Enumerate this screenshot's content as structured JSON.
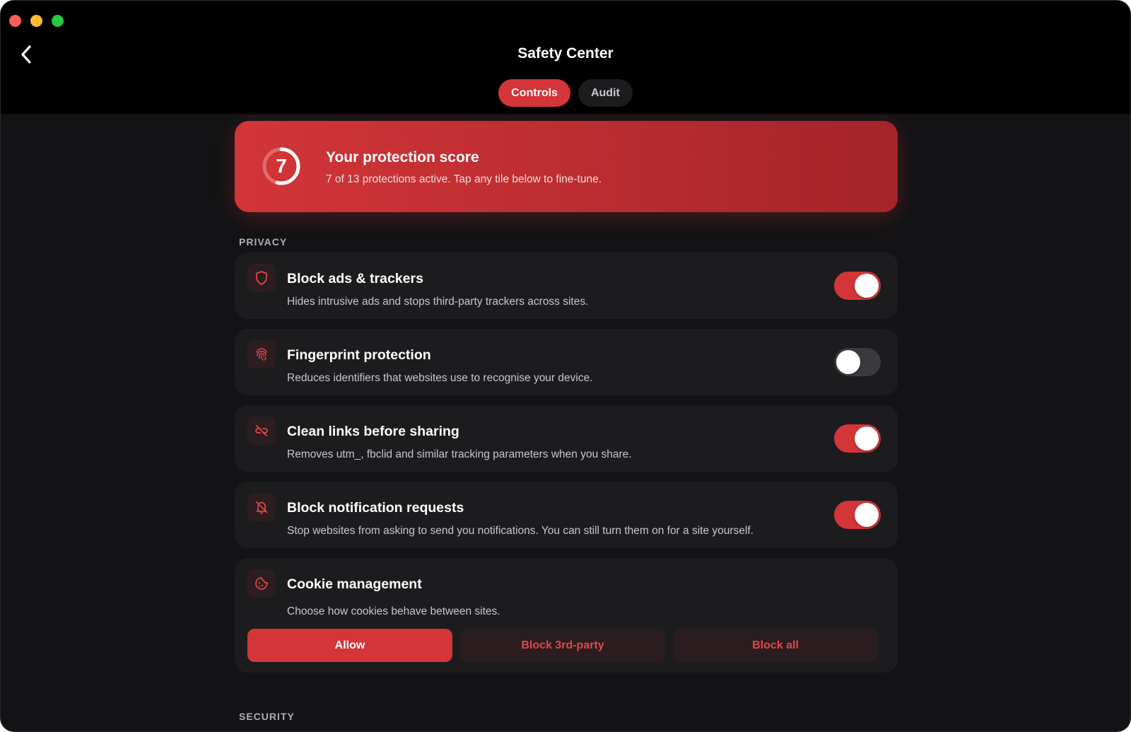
{
  "header": {
    "title": "Safety Center",
    "tabs": [
      {
        "label": "Controls",
        "active": true
      },
      {
        "label": "Audit",
        "active": false
      }
    ]
  },
  "score": {
    "value": "7",
    "active": 7,
    "total": 13,
    "title": "Your protection score",
    "subtitle": "7 of 13 protections active. Tap any tile below to fine-tune."
  },
  "sections": {
    "privacy_label": "PRIVACY",
    "security_label": "SECURITY"
  },
  "privacy": [
    {
      "icon": "shield-icon",
      "title": "Block ads & trackers",
      "description": "Hides intrusive ads and stops third-party trackers across sites.",
      "enabled": true
    },
    {
      "icon": "fingerprint-icon",
      "title": "Fingerprint protection",
      "description": "Reduces identifiers that websites use to recognise your device.",
      "enabled": false
    },
    {
      "icon": "unlink-icon",
      "title": "Clean links before sharing",
      "description": "Removes utm_, fbclid and similar tracking parameters when you share.",
      "enabled": true
    },
    {
      "icon": "bell-off-icon",
      "title": "Block notification requests",
      "description": "Stop websites from asking to send you notifications. You can still turn them on for a site yourself.",
      "enabled": true
    }
  ],
  "cookies": {
    "icon": "cookie-icon",
    "title": "Cookie management",
    "description": "Choose how cookies behave between sites.",
    "options": [
      "Allow",
      "Block 3rd-party",
      "Block all"
    ],
    "selected": "Allow"
  },
  "colors": {
    "accent": "#d33538",
    "background": "#131315",
    "card": "#1c1c1f"
  }
}
